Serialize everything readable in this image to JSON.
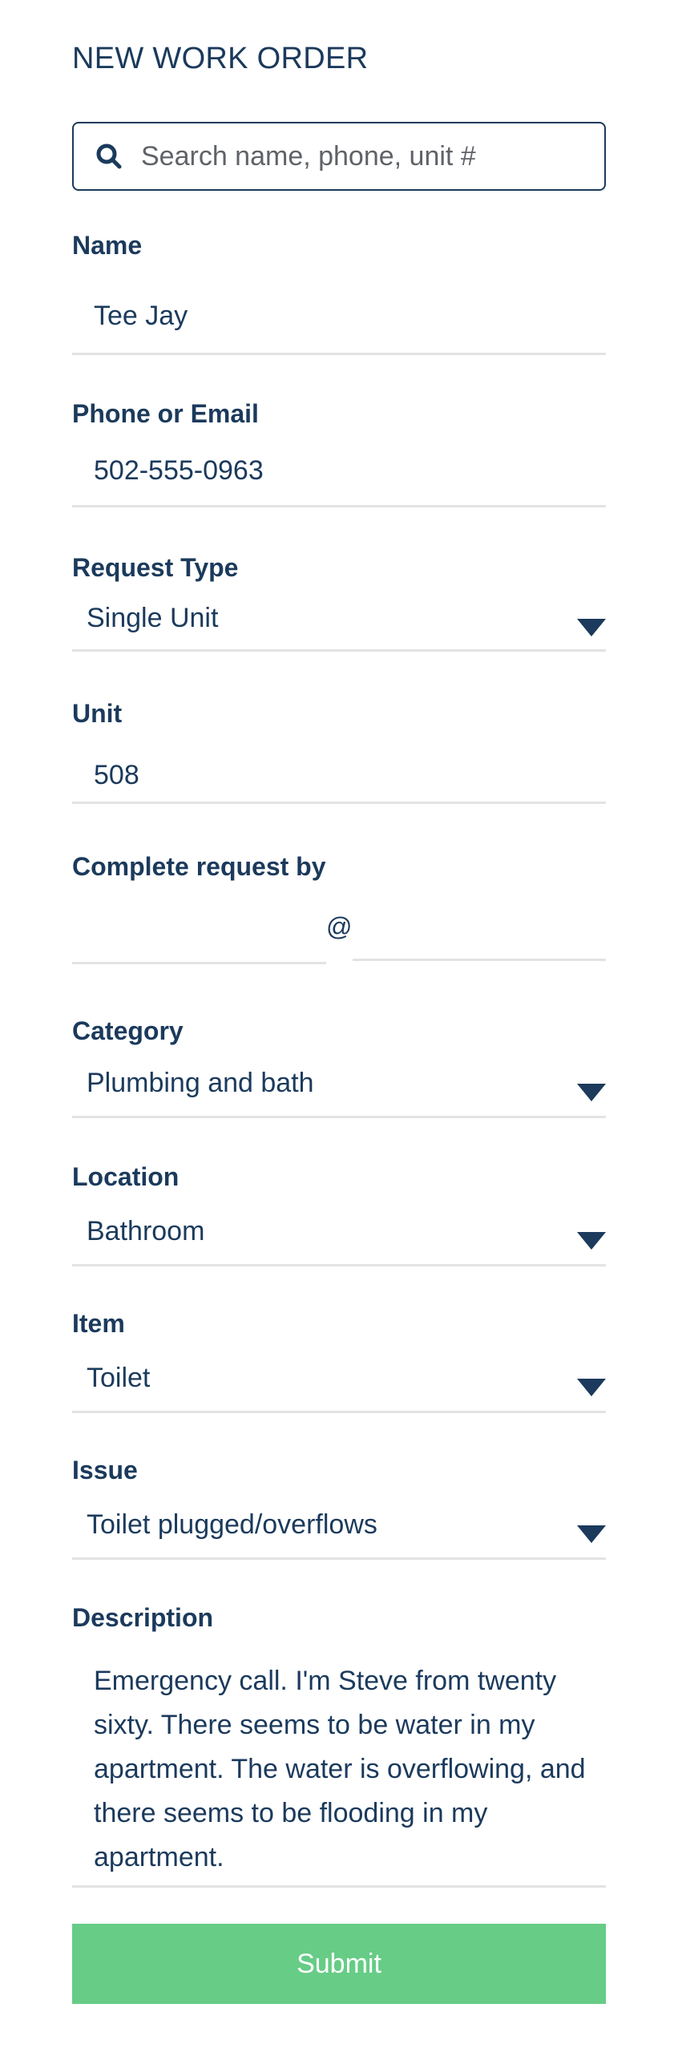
{
  "header": {
    "title": "NEW WORK ORDER"
  },
  "search": {
    "placeholder": "Search name, phone, unit #",
    "value": "",
    "icon": "search-icon"
  },
  "form": {
    "name": {
      "label": "Name",
      "value": "Tee Jay"
    },
    "contact": {
      "label": "Phone or Email",
      "value": "502-555-0963"
    },
    "request_type": {
      "label": "Request Type",
      "value": "Single Unit"
    },
    "unit": {
      "label": "Unit",
      "value": "508"
    },
    "complete_by": {
      "label": "Complete request by",
      "date_value": "",
      "separator": "@",
      "time_value": ""
    },
    "category": {
      "label": "Category",
      "value": "Plumbing and bath"
    },
    "location": {
      "label": "Location",
      "value": "Bathroom"
    },
    "item": {
      "label": "Item",
      "value": "Toilet"
    },
    "issue": {
      "label": "Issue",
      "value": "Toilet plugged/overflows"
    },
    "description": {
      "label": "Description",
      "value": "Emergency call. I'm Steve from twenty sixty. There seems to be water in my apartment. The water is overflowing, and there seems to be flooding in my apartment."
    }
  },
  "actions": {
    "submit_label": "Submit"
  },
  "colors": {
    "primary": "#1b3a5c",
    "submit": "#66cc86",
    "divider": "#e3e3e3"
  }
}
